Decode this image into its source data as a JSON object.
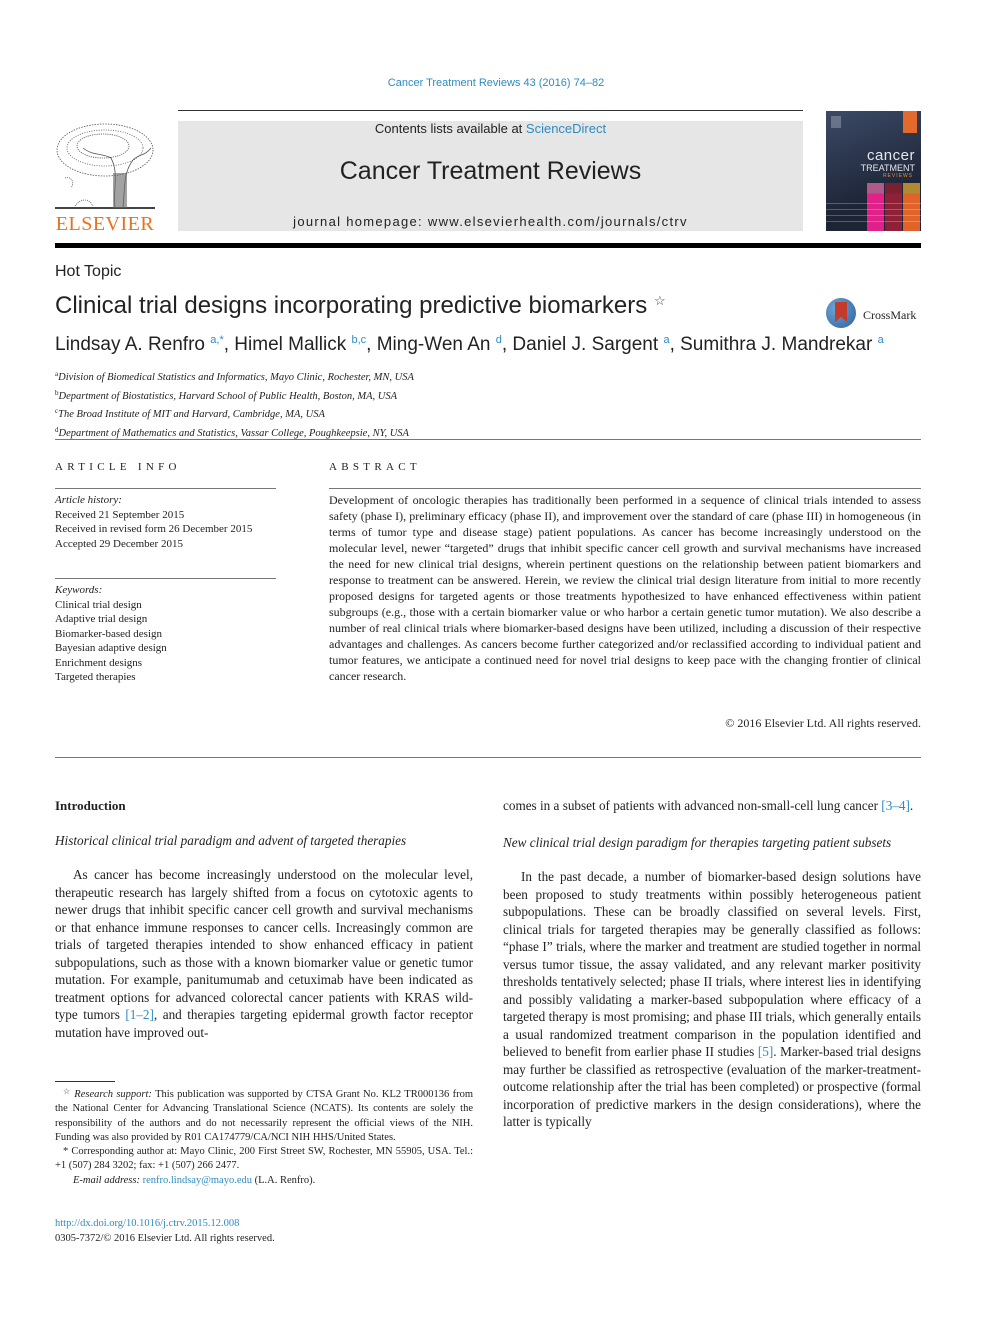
{
  "header": {
    "journal_ref": "Cancer Treatment Reviews 43 (2016) 74–82",
    "publisher_logo_text": "ELSEVIER",
    "contents_prefix": "Contents lists available at ",
    "contents_link": "ScienceDirect",
    "journal_title": "Cancer Treatment Reviews",
    "homepage_prefix": "journal homepage: ",
    "homepage_url": "www.elsevierhealth.com/journals/ctrv",
    "cover": {
      "line1": "cancer",
      "line2": "TREATMENT",
      "line3": "REVIEWS"
    }
  },
  "article": {
    "type": "Hot Topic",
    "title": "Clinical trial designs incorporating predictive biomarkers",
    "title_mark": "☆",
    "crossmark_label": "CrossMark",
    "authors": [
      {
        "name": "Lindsay A. Renfro",
        "sup": "a,*",
        "sep": ", "
      },
      {
        "name": "Himel Mallick",
        "sup": "b,c",
        "sep": ", "
      },
      {
        "name": "Ming-Wen An",
        "sup": "d",
        "sep": ", "
      },
      {
        "name": "Daniel J. Sargent",
        "sup": "a",
        "sep": ", "
      },
      {
        "name": "Sumithra J. Mandrekar",
        "sup": "a",
        "sep": ""
      }
    ],
    "affiliations": [
      {
        "key": "a",
        "text": "Division of Biomedical Statistics and Informatics, Mayo Clinic, Rochester, MN, USA"
      },
      {
        "key": "b",
        "text": "Department of Biostatistics, Harvard School of Public Health, Boston, MA, USA"
      },
      {
        "key": "c",
        "text": "The Broad Institute of MIT and Harvard, Cambridge, MA, USA"
      },
      {
        "key": "d",
        "text": "Department of Mathematics and Statistics, Vassar College, Poughkeepsie, NY, USA"
      }
    ]
  },
  "article_info": {
    "heading": "ARTICLE INFO",
    "history_label": "Article history:",
    "history": [
      "Received 21 September 2015",
      "Received in revised form 26 December 2015",
      "Accepted 29 December 2015"
    ],
    "keywords_label": "Keywords:",
    "keywords": [
      "Clinical trial design",
      "Adaptive trial design",
      "Biomarker-based design",
      "Bayesian adaptive design",
      "Enrichment designs",
      "Targeted therapies"
    ]
  },
  "abstract": {
    "heading": "ABSTRACT",
    "text": "Development of oncologic therapies has traditionally been performed in a sequence of clinical trials intended to assess safety (phase I), preliminary efficacy (phase II), and improvement over the standard of care (phase III) in homogeneous (in terms of tumor type and disease stage) patient populations. As cancer has become increasingly understood on the molecular level, newer “targeted” drugs that inhibit specific cancer cell growth and survival mechanisms have increased the need for new clinical trial designs, wherein pertinent questions on the relationship between patient biomarkers and response to treatment can be answered. Herein, we review the clinical trial design literature from initial to more recently proposed designs for targeted agents or those treatments hypothesized to have enhanced effectiveness within patient subgroups (e.g., those with a certain biomarker value or who harbor a certain genetic tumor mutation). We also describe a number of real clinical trials where biomarker-based designs have been utilized, including a discussion of their respective advantages and challenges. As cancers become further categorized and/or reclassified according to individual patient and tumor features, we anticipate a continued need for novel trial designs to keep pace with the changing frontier of clinical cancer research.",
    "copyright": "© 2016 Elsevier Ltd. All rights reserved."
  },
  "body": {
    "intro_heading": "Introduction",
    "sub1_heading": "Historical clinical trial paradigm and advent of targeted therapies",
    "para1_a": "As cancer has become increasingly understood on the molecular level, therapeutic research has largely shifted from a focus on cytotoxic agents to newer drugs that inhibit specific cancer cell growth and survival mechanisms or that enhance immune responses to cancer cells. Increasingly common are trials of targeted therapies intended to show enhanced efficacy in patient subpopulations, such as those with a known biomarker value or genetic tumor mutation. For example, panitumumab and cetuximab have been indicated as treatment options for advanced colorectal cancer patients with KRAS wild-type tumors ",
    "para1_ref1": "[1–2]",
    "para1_b": ", and therapies targeting epidermal growth factor receptor mutation have improved out-",
    "para1_c": "comes in a subset of patients with advanced non-small-cell lung cancer ",
    "para1_ref2": "[3–4]",
    "para1_d": ".",
    "sub2_heading": "New clinical trial design paradigm for therapies targeting patient subsets",
    "para2_a": "In the past decade, a number of biomarker-based design solutions have been proposed to study treatments within possibly heterogeneous patient subpopulations. These can be broadly classified on several levels. First, clinical trials for targeted therapies may be generally classified as follows: “phase I” trials, where the marker and treatment are studied together in normal versus tumor tissue, the assay validated, and any relevant marker positivity thresholds tentatively selected; phase II trials, where interest lies in identifying and possibly validating a marker-based subpopulation where efficacy of a targeted therapy is most promising; and phase III trials, which generally entails a usual randomized treatment comparison in the population identified and believed to benefit from earlier phase II studies ",
    "para2_ref": "[5]",
    "para2_b": ". Marker-based trial designs may further be classified as retrospective (evaluation of the marker-treatment-outcome relationship after the trial has been completed) or prospective (formal incorporation of predictive markers in the design considerations), where the latter is typically"
  },
  "footnotes": {
    "support_mark": "☆",
    "support_label": "Research support:",
    "support_text": " This publication was supported by CTSA Grant No. KL2 TR000136 from the National Center for Advancing Translational Science (NCATS). Its contents are solely the responsibility of the authors and do not necessarily represent the official views of the NIH. Funding was also provided by R01 CA174779/CA/NCI NIH HHS/United States.",
    "corresponding_mark": "*",
    "corresponding_text": " Corresponding author at: Mayo Clinic, 200 First Street SW, Rochester, MN 55905, USA. Tel.: +1 (507) 284 3202; fax: +1 (507) 266 2477.",
    "email_label": "E-mail address:",
    "email": "renfro.lindsay@mayo.edu",
    "email_suffix": " (L.A. Renfro).",
    "doi": "http://dx.doi.org/10.1016/j.ctrv.2015.12.008",
    "issn_line": "0305-7372/© 2016 Elsevier Ltd. All rights reserved."
  },
  "colors": {
    "link": "#2e8bbf",
    "elsevier_orange": "#e9711c",
    "banner_bg": "#e6e6e6"
  }
}
